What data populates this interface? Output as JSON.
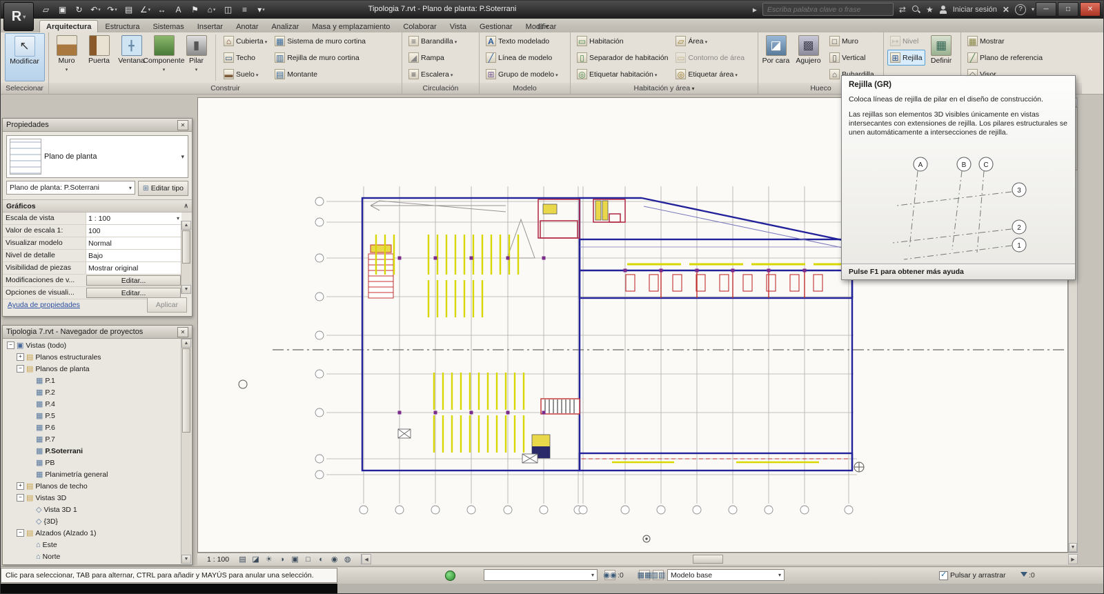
{
  "colors": {
    "accent_blue": "#56a0d8",
    "wall_blue": "#22229a",
    "parking_yellow": "#d8d800",
    "fixture_red": "#c03030",
    "link_blue": "#2a4fa0"
  },
  "titlebar": {
    "title": "Tipologia 7.rvt - Plano de planta: P.Soterrani",
    "search_placeholder": "Escriba palabra clave o frase",
    "signin": "Iniciar sesión",
    "qat": [
      {
        "icon": "open-icon"
      },
      {
        "icon": "save-icon"
      },
      {
        "icon": "sync-icon"
      },
      {
        "icon": "undo-icon",
        "arrow": true
      },
      {
        "icon": "redo-icon",
        "arrow": true
      },
      {
        "icon": "print-icon"
      },
      {
        "icon": "measure-icon",
        "arrow": true
      },
      {
        "icon": "dimension-icon"
      },
      {
        "icon": "text-icon"
      },
      {
        "icon": "tag-icon"
      },
      {
        "icon": "view3d-icon",
        "arrow": true
      },
      {
        "icon": "section-icon"
      },
      {
        "icon": "thin-lines-icon"
      },
      {
        "icon": "customize-qat-icon",
        "arrow": true
      }
    ]
  },
  "ribbon": {
    "tabs": [
      {
        "label": "Arquitectura",
        "active": true
      },
      {
        "label": "Estructura"
      },
      {
        "label": "Sistemas"
      },
      {
        "label": "Insertar"
      },
      {
        "label": "Anotar"
      },
      {
        "label": "Analizar"
      },
      {
        "label": "Masa y emplazamiento"
      },
      {
        "label": "Colaborar"
      },
      {
        "label": "Vista"
      },
      {
        "label": "Gestionar"
      },
      {
        "label": "Modificar"
      }
    ],
    "panels": {
      "seleccionar_label": "Seleccionar",
      "modificar": "Modificar",
      "construir_label": "Construir",
      "construir_big": [
        {
          "label": "Muro",
          "icon": "wall-icon",
          "arrow": true
        },
        {
          "label": "Puerta",
          "icon": "door-icon"
        },
        {
          "label": "Ventana",
          "icon": "window-icon"
        },
        {
          "label": "Componente",
          "icon": "component-icon",
          "arrow": true
        },
        {
          "label": "Pilar",
          "icon": "column-icon",
          "arrow": true
        }
      ],
      "construir_small_a": [
        {
          "label": "Cubierta",
          "icon": "roof-icon",
          "arrow": true
        },
        {
          "label": "Techo",
          "icon": "ceiling-icon"
        },
        {
          "label": "Suelo",
          "icon": "floor-icon",
          "arrow": true
        }
      ],
      "construir_small_b": [
        {
          "label": "Sistema de muro cortina",
          "icon": "curtain-system-icon"
        },
        {
          "label": "Rejilla de muro cortina",
          "icon": "curtain-grid-icon"
        },
        {
          "label": "Montante",
          "icon": "mullion-icon"
        }
      ],
      "circulacion_label": "Circulación",
      "circulacion": [
        {
          "label": "Barandilla",
          "icon": "railing-icon",
          "arrow": true
        },
        {
          "label": "Rampa",
          "icon": "ramp-icon"
        },
        {
          "label": "Escalera",
          "icon": "stair-icon",
          "arrow": true
        }
      ],
      "modelo_label": "Modelo",
      "modelo": [
        {
          "label": "Texto modelado",
          "icon": "model-text-icon"
        },
        {
          "label": "Línea de modelo",
          "icon": "model-line-icon"
        },
        {
          "label": "Grupo de modelo",
          "icon": "model-group-icon",
          "arrow": true
        }
      ],
      "habitacion_label": "Habitación y área",
      "habitacion_a": [
        {
          "label": "Habitación",
          "icon": "room-icon"
        },
        {
          "label": "Separador de habitación",
          "icon": "room-separator-icon"
        },
        {
          "label": "Etiquetar habitación",
          "icon": "tag-room-icon",
          "arrow": true
        }
      ],
      "habitacion_b": [
        {
          "label": "Área",
          "icon": "area-icon",
          "arrow": true
        },
        {
          "label": "Contorno de área",
          "icon": "area-boundary-icon",
          "disabled": true
        },
        {
          "label": "Etiquetar área",
          "icon": "tag-area-icon",
          "arrow": true
        }
      ],
      "hueco_label": "Hueco",
      "hueco_big": [
        {
          "label": "Por cara",
          "icon": "opening-by-face-icon"
        },
        {
          "label": "Agujero",
          "icon": "shaft-icon"
        }
      ],
      "hueco_small": [
        {
          "label": "Muro",
          "icon": "wall-opening-icon"
        },
        {
          "label": "Vertical",
          "icon": "vertical-opening-icon"
        },
        {
          "label": "Buhardilla",
          "icon": "dormer-icon"
        }
      ],
      "nivel": "Nivel",
      "rejilla": "Rejilla",
      "definir": "Definir",
      "plano_trabajo": [
        {
          "label": "Mostrar",
          "icon": "show-workplane-icon"
        },
        {
          "label": "Plano de referencia",
          "icon": "ref-plane-icon"
        },
        {
          "label": "Visor",
          "icon": "viewer-icon"
        }
      ]
    }
  },
  "properties": {
    "title": "Propiedades",
    "type_name": "Plano de planta",
    "selector": "Plano de planta: P.Soterrani",
    "edit_type": "Editar tipo",
    "section": "Gráficos",
    "rows": [
      {
        "name": "Escala de vista",
        "value": "1 : 100",
        "type": "select"
      },
      {
        "name": "Valor de escala 1:",
        "value": "100",
        "type": "input"
      },
      {
        "name": "Visualizar modelo",
        "value": "Normal",
        "type": "input"
      },
      {
        "name": "Nivel de detalle",
        "value": "Bajo",
        "type": "input"
      },
      {
        "name": "Visibilidad de piezas",
        "value": "Mostrar original",
        "type": "input"
      },
      {
        "name": "Modificaciones de v...",
        "value": "Editar...",
        "type": "button"
      },
      {
        "name": "Opciones de visuali...",
        "value": "Editar...",
        "type": "button"
      }
    ],
    "help_link": "Ayuda de propiedades",
    "apply": "Aplicar"
  },
  "browser": {
    "title": "Tipologia 7.rvt - Navegador de proyectos",
    "items": [
      {
        "label": "Vistas (todo)",
        "level": 0,
        "exp": "−",
        "icon": "views-icon"
      },
      {
        "label": "Planos estructurales",
        "level": 1,
        "exp": "+",
        "icon": "folder-icon"
      },
      {
        "label": "Planos de planta",
        "level": 1,
        "exp": "−",
        "icon": "folder-icon"
      },
      {
        "label": "P.1",
        "level": 2,
        "icon": "plan-view-icon"
      },
      {
        "label": "P.2",
        "level": 2,
        "icon": "plan-view-icon"
      },
      {
        "label": "P.4",
        "level": 2,
        "icon": "plan-view-icon"
      },
      {
        "label": "P.5",
        "level": 2,
        "icon": "plan-view-icon"
      },
      {
        "label": "P.6",
        "level": 2,
        "icon": "plan-view-icon"
      },
      {
        "label": "P.7",
        "level": 2,
        "icon": "plan-view-icon"
      },
      {
        "label": "P.Soterrani",
        "level": 2,
        "icon": "plan-view-icon",
        "bold": true
      },
      {
        "label": "PB",
        "level": 2,
        "icon": "plan-view-icon"
      },
      {
        "label": "Planimetría general",
        "level": 2,
        "icon": "plan-view-icon"
      },
      {
        "label": "Planos de techo",
        "level": 1,
        "exp": "+",
        "icon": "folder-icon"
      },
      {
        "label": "Vistas 3D",
        "level": 1,
        "exp": "−",
        "icon": "folder-icon"
      },
      {
        "label": "Vista 3D 1",
        "level": 2,
        "icon": "view3d-item-icon"
      },
      {
        "label": "{3D}",
        "level": 2,
        "icon": "view3d-item-icon"
      },
      {
        "label": "Alzados (Alzado 1)",
        "level": 1,
        "exp": "−",
        "icon": "folder-icon"
      },
      {
        "label": "Este",
        "level": 2,
        "icon": "elevation-view-icon"
      },
      {
        "label": "Norte",
        "level": 2,
        "icon": "elevation-view-icon"
      }
    ]
  },
  "viewbar": {
    "scale": "1 : 100",
    "icons": [
      {
        "icon": "detail-level-icon"
      },
      {
        "icon": "visual-style-icon"
      },
      {
        "icon": "sun-path-icon"
      },
      {
        "icon": "shadows-icon"
      },
      {
        "icon": "crop-view-icon"
      },
      {
        "icon": "show-crop-icon"
      },
      {
        "icon": "temporary-hide-icon"
      },
      {
        "icon": "reveal-hidden-icon"
      },
      {
        "icon": "analysis-icon"
      }
    ]
  },
  "statusbar": {
    "hint": "Clic para seleccionar, TAB para alternar, CTRL para añadir y MAYÚS para anular una selección.",
    "editable_count": ":0",
    "design_option": "Modelo base",
    "press_drag": "Pulsar y arrastrar",
    "filter_count": ":0"
  },
  "tooltip": {
    "title": "Rejilla (GR)",
    "p1": "Coloca líneas de rejilla de pilar en el diseño de construcción.",
    "p2": "Las rejillas son elementos 3D visibles únicamente en vistas intersecantes con extensiones de rejilla. Los pilares estructurales se unen automáticamente a intersecciones de rejilla.",
    "bubbles": {
      "a": "A",
      "b": "B",
      "c": "C",
      "n1": "1",
      "n2": "2",
      "n3": "3"
    },
    "footer": "Pulse F1 para obtener más ayuda"
  }
}
